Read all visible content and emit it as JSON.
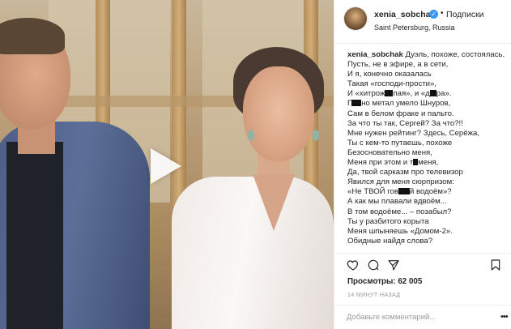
{
  "header": {
    "username": "xenia_sobchak",
    "follow_separator": "•",
    "follow_label": "Подписки",
    "location": "Saint Petersburg, Russia"
  },
  "caption": {
    "username": "xenia_sobchak",
    "lines": [
      {
        "a": "Дуэль, похоже, состоялась.",
        "b": ""
      },
      {
        "a": "Пусть, не в эфире, а в сети,",
        "b": ""
      },
      {
        "a": "И я, конечно оказалась",
        "b": ""
      },
      {
        "a": "Такая «господи-прости»,",
        "b": ""
      },
      {
        "a": "И «хитрож",
        "b": "пая», и «д",
        "c": "ра»."
      },
      {
        "a": "Г",
        "b": "но метал умело Шнуров,"
      },
      {
        "a": "Сам в белом фраке и пальто.",
        "b": ""
      },
      {
        "a": "За что ты так, Сергей? За что?!!",
        "b": ""
      },
      {
        "a": "Мне нужен рейтинг? Здесь, Серёжа,",
        "b": ""
      },
      {
        "a": "Ты с кем-то путаешь, похоже",
        "b": ""
      },
      {
        "a": "Безосновательно меня,",
        "b": ""
      },
      {
        "a": "Меня при этом и т",
        "b": "меня,"
      },
      {
        "a": "Да, твой сарказм про телевизор",
        "b": ""
      },
      {
        "a": "Явился для меня сюрпризом:",
        "b": ""
      },
      {
        "a": "«Не ТВОЙ гов",
        "b": "й водоём»?"
      },
      {
        "a": "А как мы плавали вдвоём...",
        "b": ""
      },
      {
        "a": "В том водоёме... – позабыл?",
        "b": ""
      },
      {
        "a": "Ты у разбитого корыта",
        "b": ""
      },
      {
        "a": "Меня шпыняешь «Домом-2».",
        "b": ""
      },
      {
        "a": "Обидные найдя слова?",
        "b": ""
      }
    ]
  },
  "stats": {
    "views_label": "Просмотры:",
    "views_value": "62 005",
    "time_ago": "14 МИНУТ НАЗАД"
  },
  "comment": {
    "placeholder": "Добавьте комментарий..."
  },
  "icons": [
    "heart-icon",
    "comment-icon",
    "share-icon",
    "bookmark-icon",
    "play-icon",
    "verified-icon",
    "more-icon"
  ],
  "colors": {
    "verified": "#3897f0",
    "text": "#262626",
    "muted": "#999999"
  }
}
